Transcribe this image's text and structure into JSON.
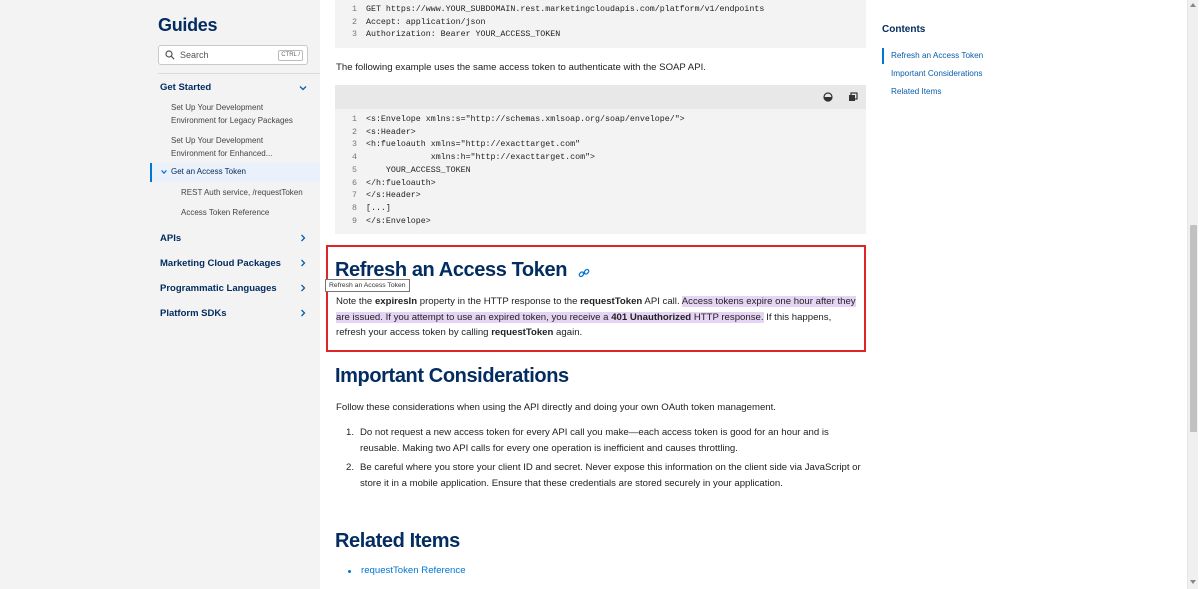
{
  "sidebar": {
    "title": "Guides",
    "search_placeholder": "Search",
    "search_shortcut": "CTRL /",
    "sections": [
      {
        "label": "Get Started",
        "expanded": true
      },
      {
        "label": "APIs"
      },
      {
        "label": "Marketing Cloud Packages"
      },
      {
        "label": "Programmatic Languages"
      },
      {
        "label": "Platform SDKs"
      }
    ],
    "items": [
      {
        "label_line1": "Set Up Your Development",
        "label_line2": "Environment for Legacy Packages"
      },
      {
        "label_line1": "Set Up Your Development",
        "label_line2": "Environment for Enhanced..."
      },
      {
        "label": "Get an Access Token",
        "active": true
      },
      {
        "label": "REST Auth service, /requestToken"
      },
      {
        "label": "Access Token Reference"
      }
    ]
  },
  "main": {
    "code_block_1": [
      {
        "n": "1",
        "text": "GET https://www.YOUR_SUBDOMAIN.rest.marketingcloudapis.com/platform/v1/endpoints"
      },
      {
        "n": "2",
        "text": "Accept: application/json"
      },
      {
        "n": "3",
        "text": "Authorization: Bearer YOUR_ACCESS_TOKEN"
      }
    ],
    "soap_intro": "The following example uses the same access token to authenticate with the SOAP API.",
    "code_block_2": [
      {
        "n": "1",
        "text": "<s:Envelope xmlns:s=\"http://schemas.xmlsoap.org/soap/envelope/\">"
      },
      {
        "n": "2",
        "text": "<s:Header>"
      },
      {
        "n": "3",
        "text": "<h:fueloauth xmlns=\"http://exacttarget.com\""
      },
      {
        "n": "4",
        "text": "             xmlns:h=\"http://exacttarget.com\">"
      },
      {
        "n": "5",
        "text": "    YOUR_ACCESS_TOKEN"
      },
      {
        "n": "6",
        "text": "</h:fueloauth>"
      },
      {
        "n": "7",
        "text": "</s:Header>"
      },
      {
        "n": "8",
        "text": "[...]"
      },
      {
        "n": "9",
        "text": "</s:Envelope>"
      }
    ],
    "refresh": {
      "heading": "Refresh an Access Token",
      "tooltip": "Refresh an Access Token",
      "p_a": "Note the ",
      "p_b": "expiresIn",
      "p_c": " property in the HTTP response to the ",
      "p_d": "requestToken",
      "p_e": " API call. ",
      "p_f": "Access tokens expire one hour after they are issued. If you attempt to use an expired token, you receive a ",
      "p_g": "401 Unauthorized",
      "p_h": " HTTP response.",
      "p_i": " If this happens, refresh your access token by calling ",
      "p_j": "requestToken",
      "p_k": " again."
    },
    "considerations": {
      "heading": "Important Considerations",
      "intro": "Follow these considerations when using the API directly and doing your own OAuth token management.",
      "items": [
        {
          "num": "1.",
          "text": "Do not request a new access token for every API call you make—each access token is good for an hour and is reusable. Making two API calls for every one operation is inefficient and causes throttling."
        },
        {
          "num": "2.",
          "text": "Be careful where you store your client ID and secret. Never expose this information on the client side via JavaScript or store it in a mobile application. Ensure that these credentials are stored securely in your application."
        }
      ]
    },
    "related": {
      "heading": "Related Items",
      "links": [
        "requestToken Reference"
      ]
    }
  },
  "toc": {
    "title": "Contents",
    "items": [
      "Refresh an Access Token",
      "Important Considerations",
      "Related Items"
    ]
  },
  "colors": {
    "brand_navy": "#032d60",
    "link_blue": "#0176d3",
    "highlight": "#e6d4f5",
    "callout_red": "#e0252a"
  }
}
